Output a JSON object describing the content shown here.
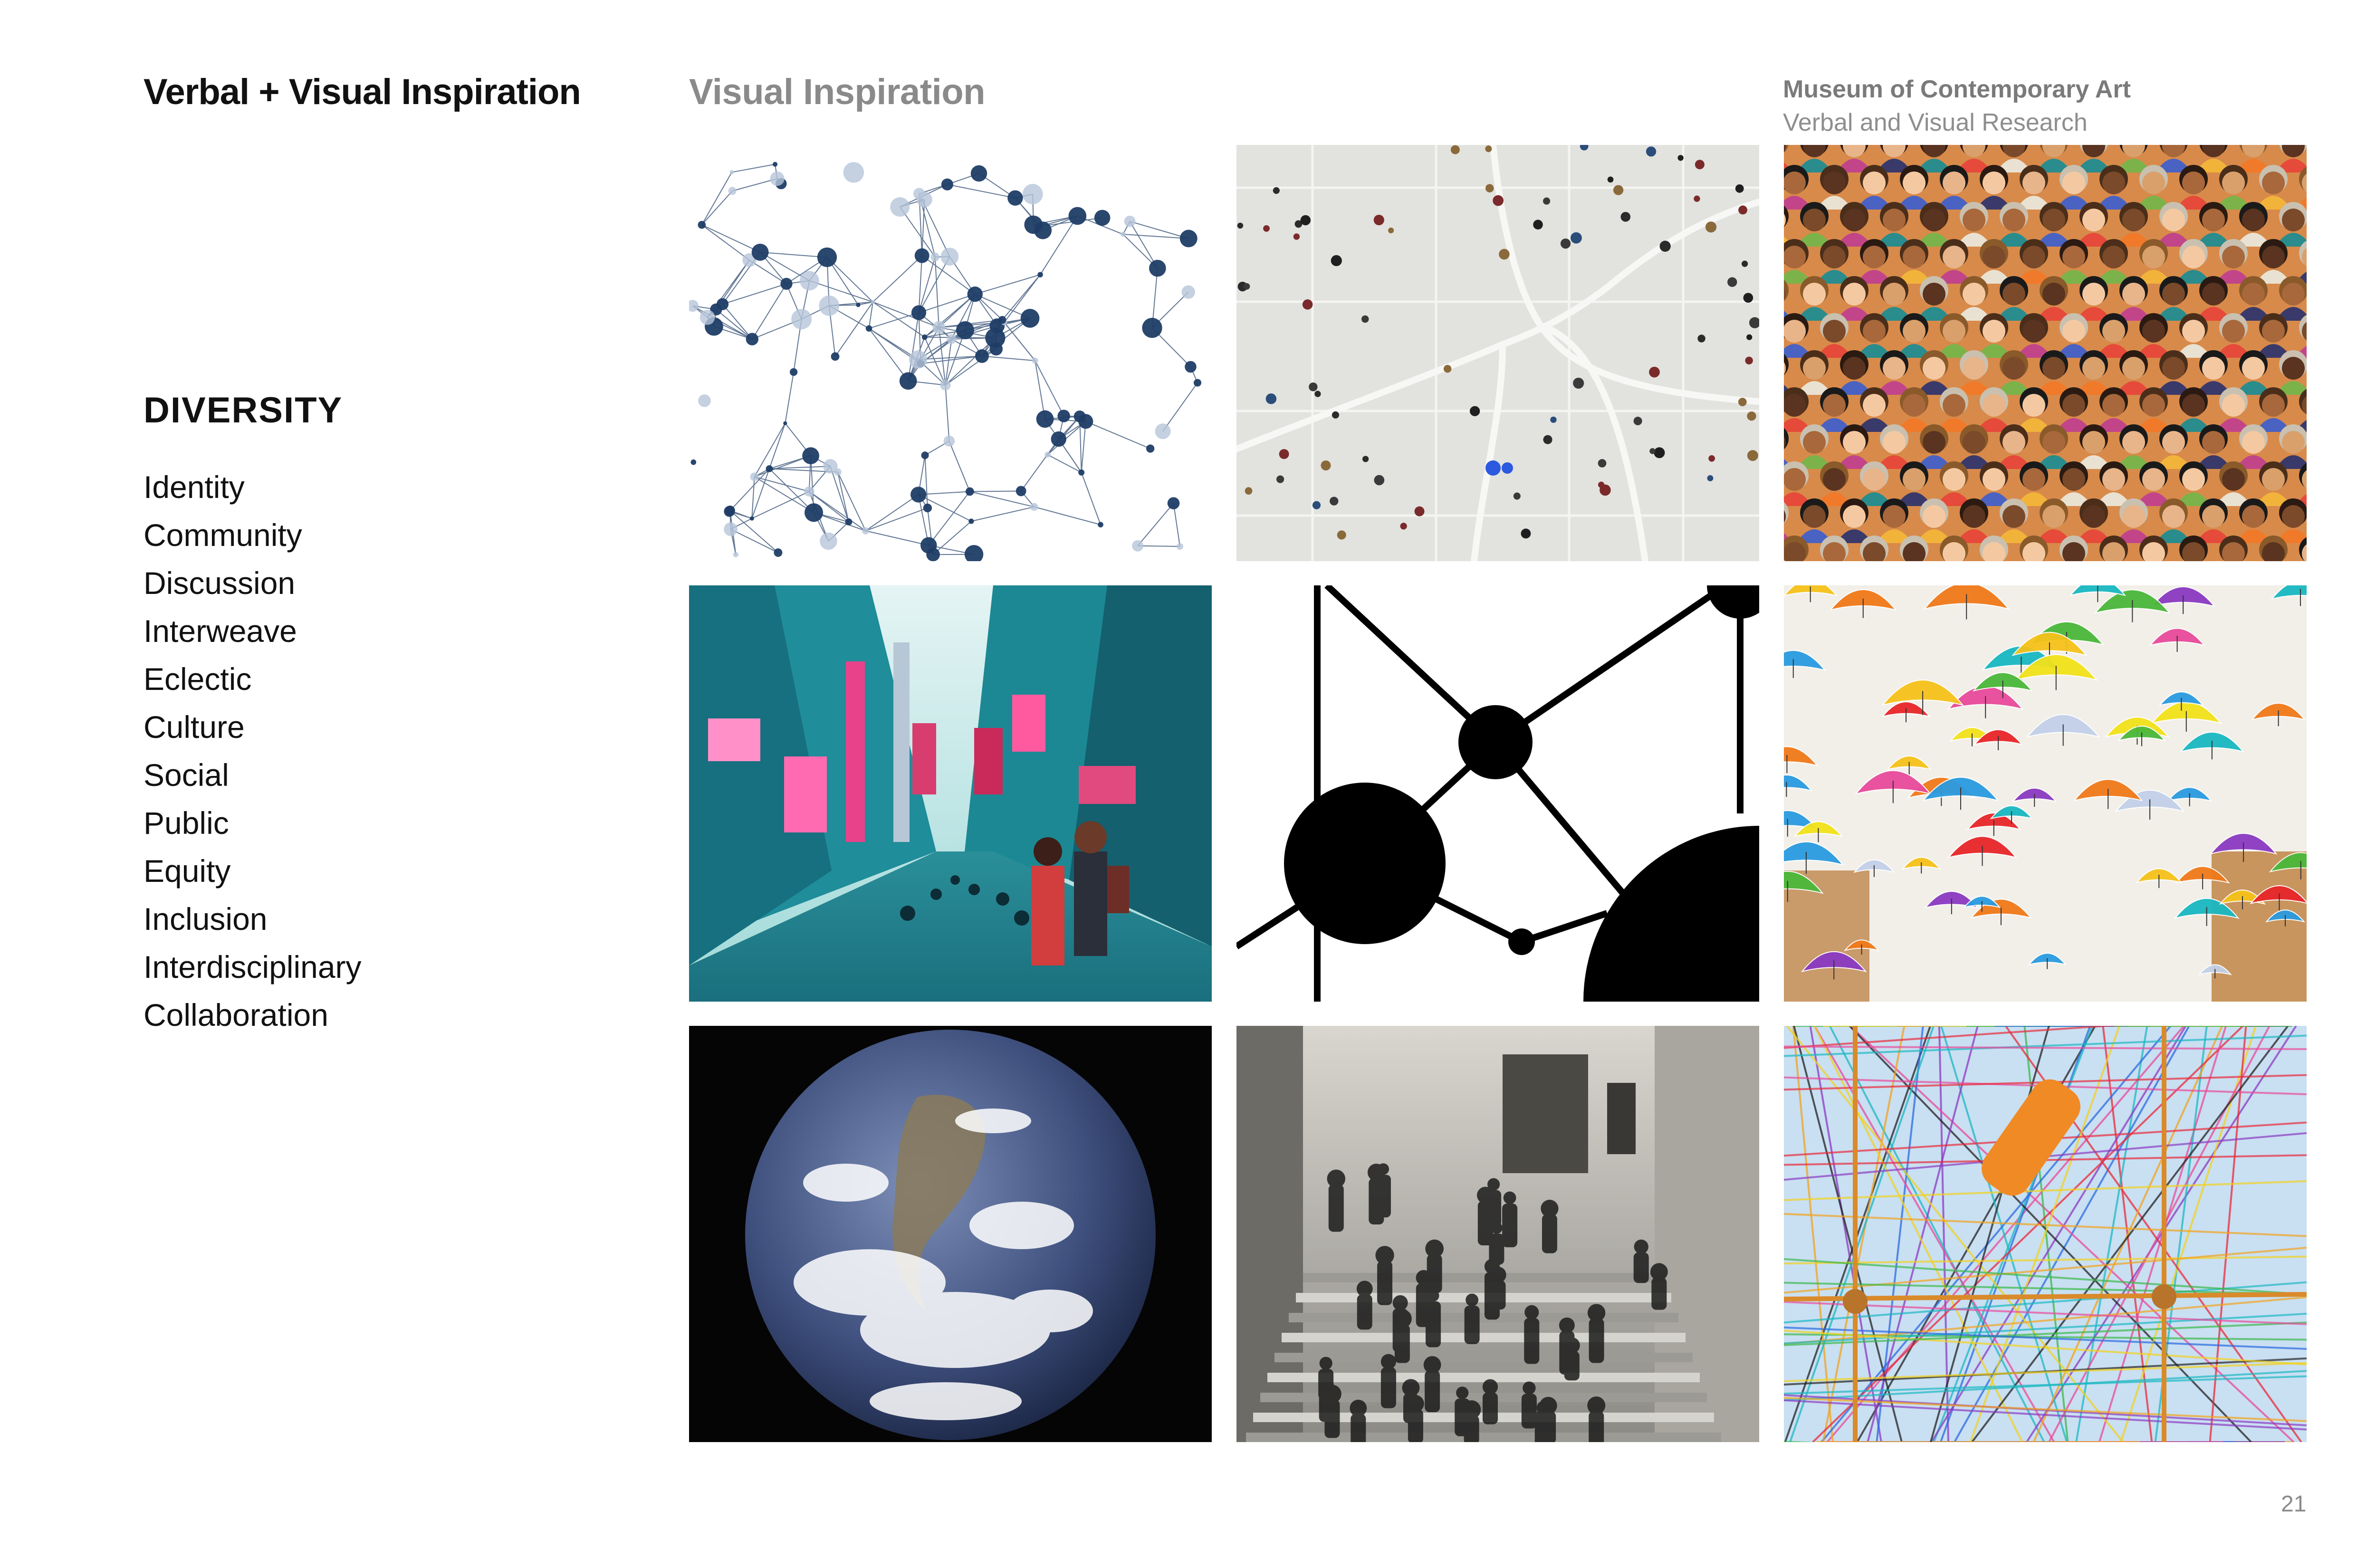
{
  "header": {
    "section_title": "Verbal + Visual Inspiration",
    "grid_title": "Visual Inspiration",
    "museum_name": "Museum of Contemporary Art",
    "museum_subtitle": "Verbal and Visual Research"
  },
  "theme": {
    "heading": "DIVERSITY",
    "words": [
      "Identity",
      "Community",
      "Discussion",
      "Interweave",
      "Eclectic",
      "Culture",
      "Social",
      "Public",
      "Equity",
      "Inclusion",
      "Interdisciplinary",
      "Collaboration"
    ]
  },
  "images": [
    {
      "name": "network-nodes-image",
      "subject": "network of connected nodes"
    },
    {
      "name": "aerial-plaza-people-image",
      "subject": "aerial view of people crossing a plaza"
    },
    {
      "name": "diverse-crowd-illustration",
      "subject": "illustrated crowd of diverse faces"
    },
    {
      "name": "neon-city-street-image",
      "subject": "neon city street at night"
    },
    {
      "name": "molecule-graph-image",
      "subject": "black circles connected by lines"
    },
    {
      "name": "colorful-umbrellas-image",
      "subject": "colorful umbrellas suspended over a street"
    },
    {
      "name": "earth-globe-image",
      "subject": "planet Earth from space"
    },
    {
      "name": "crowd-on-stairs-image",
      "subject": "black and white crowd on stairs"
    },
    {
      "name": "colored-threads-image",
      "subject": "multicolored threads crossing"
    }
  ],
  "colors": {
    "network_blue": "#1f3d66",
    "plaza_gray": "#e2e2df",
    "neon_teal": "#2bb5c0",
    "neon_pink": "#e8428a",
    "earth_space": "#050505",
    "thread_bg": "#c9dff2"
  },
  "footer": {
    "page_number": "21"
  }
}
